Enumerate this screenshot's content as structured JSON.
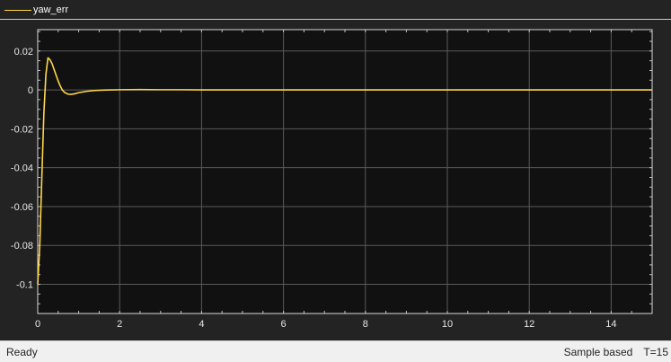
{
  "legend": {
    "entries": [
      {
        "label": "yaw_err",
        "color": "#ffd54a"
      }
    ]
  },
  "status": {
    "state": "Ready",
    "mode": "Sample based",
    "time": "T=15"
  },
  "colors": {
    "background": "#232323",
    "axes_background": "#111111",
    "grid": "#5a5a5a",
    "axis_text": "#e6e6e6",
    "status_background": "#f0f0f0"
  },
  "chart_data": {
    "type": "line",
    "title": "",
    "xlabel": "",
    "ylabel": "",
    "xlim": [
      0,
      15
    ],
    "ylim": [
      -0.115,
      0.031
    ],
    "xticks": [
      0,
      2,
      4,
      6,
      8,
      10,
      12,
      14
    ],
    "yticks": [
      0.02,
      0,
      -0.02,
      -0.04,
      -0.06,
      -0.08,
      -0.1
    ],
    "xtick_labels": [
      "0",
      "2",
      "4",
      "6",
      "8",
      "10",
      "12",
      "14"
    ],
    "ytick_labels": [
      "0.02",
      "0",
      "-0.02",
      "-0.04",
      "-0.06",
      "-0.08",
      "-0.1"
    ],
    "grid": true,
    "legend_position": "top-left",
    "series": [
      {
        "name": "yaw_err",
        "color": "#ffd54a",
        "x": [
          0,
          0.05,
          0.1,
          0.15,
          0.2,
          0.25,
          0.3,
          0.35,
          0.4,
          0.45,
          0.5,
          0.55,
          0.6,
          0.65,
          0.7,
          0.75,
          0.8,
          0.9,
          1.0,
          1.2,
          1.4,
          1.6,
          1.8,
          2.0,
          2.5,
          3.0,
          3.5,
          4.0,
          5.0,
          6.0,
          8.0,
          10.0,
          12.0,
          14.0,
          15.0
        ],
        "y": [
          -0.1,
          -0.08,
          -0.045,
          -0.012,
          0.008,
          0.0165,
          0.0155,
          0.0135,
          0.0105,
          0.0075,
          0.0045,
          0.002,
          0.0,
          -0.0012,
          -0.0018,
          -0.0022,
          -0.0023,
          -0.002,
          -0.0014,
          -0.0007,
          -0.0003,
          -0.0001,
          0.0,
          0.0001,
          0.0002,
          0.0001,
          0.0001,
          0.0,
          0.0,
          0.0,
          0.0,
          0.0,
          0.0,
          0.0,
          0.0
        ]
      }
    ]
  }
}
